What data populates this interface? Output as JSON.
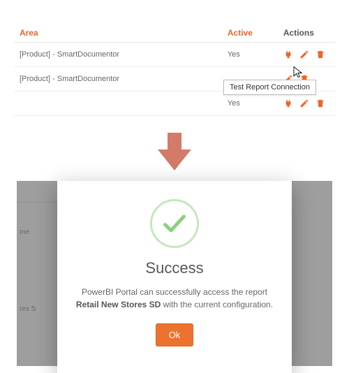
{
  "table": {
    "headers": {
      "area": "Area",
      "active": "Active",
      "actions": "Actions"
    },
    "rows": [
      {
        "area": "[Product] - SmartDocumentor",
        "active": "Yes"
      },
      {
        "area": "[Product] - SmartDocumentor",
        "active": ""
      },
      {
        "area": "",
        "active": "Yes"
      }
    ]
  },
  "tooltip": "Test Report Connection",
  "overlay": {
    "bg_text1": "me",
    "bg_text2": "res S"
  },
  "modal": {
    "title": "Success",
    "msg_pre": "PowerBI Portal can successfully access the report ",
    "msg_bold": "Retail New Stores SD",
    "msg_post": " with the current configuration.",
    "ok": "Ok"
  }
}
